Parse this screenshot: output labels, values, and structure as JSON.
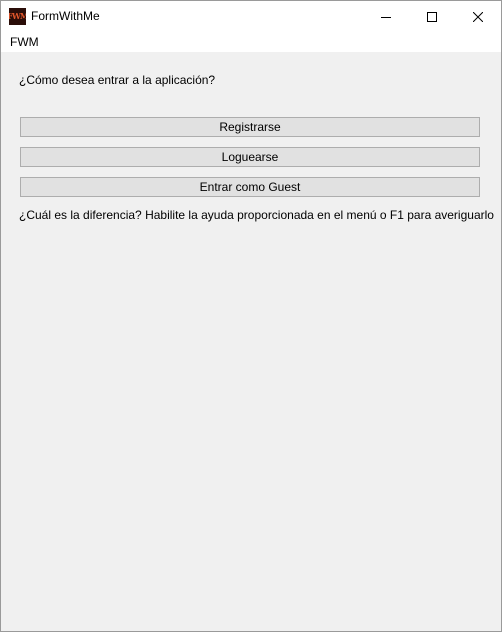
{
  "window": {
    "title": "FormWithMe",
    "icon_text": "FWM",
    "icon_name": "fwm-app-icon"
  },
  "menubar": {
    "items": [
      {
        "label": "FWM"
      }
    ]
  },
  "main": {
    "prompt": "¿Cómo desea entrar a la aplicación?",
    "buttons": [
      {
        "label": "Registrarse"
      },
      {
        "label": "Loguearse"
      },
      {
        "label": "Entrar como Guest"
      }
    ],
    "help_text": "¿Cuál es la diferencia? Habilite la ayuda proporcionada en el menú o F1 para averiguarlo"
  },
  "colors": {
    "window_bg": "#f0f0f0",
    "titlebar_bg": "#ffffff",
    "button_bg": "#e1e1e1",
    "button_border": "#adadad"
  }
}
